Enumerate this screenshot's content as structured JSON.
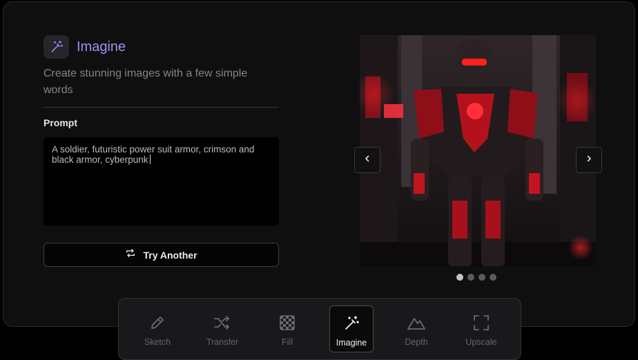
{
  "header": {
    "title": "Imagine",
    "subtitle": "Create stunning images with a few simple words",
    "icon": "magic-wand-icon",
    "accent_color": "#a48ff3"
  },
  "prompt": {
    "label": "Prompt",
    "value": "A soldier, futuristic power suit armor, crimson and black armor, cyberpunk"
  },
  "try_another": {
    "label": "Try Another",
    "icon": "repeat-icon"
  },
  "carousel": {
    "image_alt": "Red and black armored cyberpunk soldier standing in a rainy neon city street",
    "prev_icon": "chevron-left-icon",
    "next_icon": "chevron-right-icon",
    "dot_count": 4,
    "active_index": 0
  },
  "toolbar": {
    "items": [
      {
        "label": "Sketch",
        "icon": "pencil-icon"
      },
      {
        "label": "Transfer",
        "icon": "shuffle-icon"
      },
      {
        "label": "Fill",
        "icon": "checker-icon"
      },
      {
        "label": "Imagine",
        "icon": "magic-wand-icon"
      },
      {
        "label": "Depth",
        "icon": "mountain-icon"
      },
      {
        "label": "Upscale",
        "icon": "expand-icon"
      }
    ],
    "active_index": 3
  }
}
